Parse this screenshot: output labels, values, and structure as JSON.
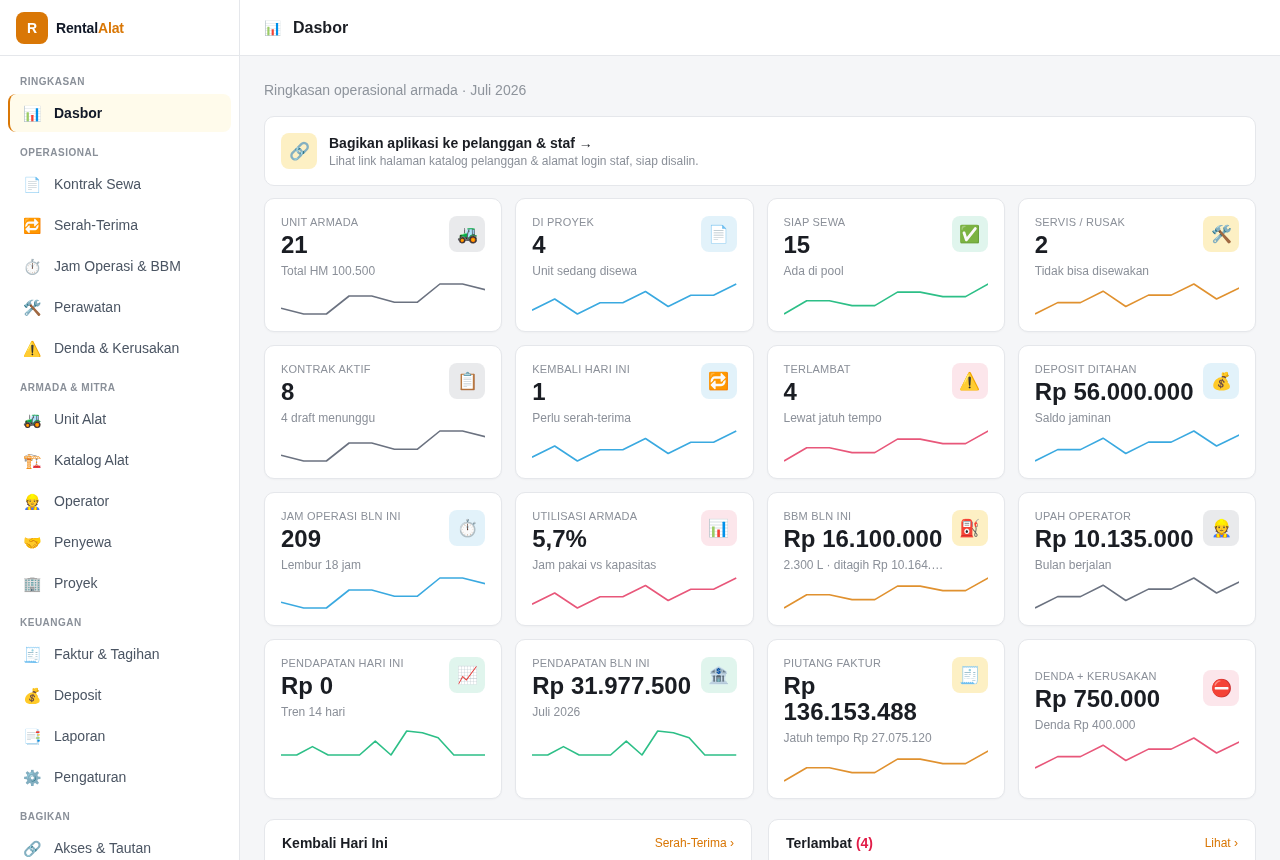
{
  "brand": {
    "logo": "R",
    "name": "Rental",
    "accent": "Alat"
  },
  "sidebar": {
    "sections": [
      {
        "title": "RINGKASAN",
        "items": [
          {
            "icon": "📊",
            "label": "Dasbor",
            "selected": true
          }
        ]
      },
      {
        "title": "OPERASIONAL",
        "items": [
          {
            "icon": "📄",
            "label": "Kontrak Sewa",
            "selected": false
          },
          {
            "icon": "🔁",
            "label": "Serah-Terima",
            "selected": false
          },
          {
            "icon": "⏱️",
            "label": "Jam Operasi & BBM",
            "selected": false
          },
          {
            "icon": "🛠️",
            "label": "Perawatan",
            "selected": false
          },
          {
            "icon": "⚠️",
            "label": "Denda & Kerusakan",
            "selected": false
          }
        ]
      },
      {
        "title": "ARMADA & MITRA",
        "items": [
          {
            "icon": "🚜",
            "label": "Unit Alat",
            "selected": false
          },
          {
            "icon": "🏗️",
            "label": "Katalog Alat",
            "selected": false
          },
          {
            "icon": "👷",
            "label": "Operator",
            "selected": false
          },
          {
            "icon": "🤝",
            "label": "Penyewa",
            "selected": false
          },
          {
            "icon": "🏢",
            "label": "Proyek",
            "selected": false
          }
        ]
      },
      {
        "title": "KEUANGAN",
        "items": [
          {
            "icon": "🧾",
            "label": "Faktur & Tagihan",
            "selected": false
          },
          {
            "icon": "💰",
            "label": "Deposit",
            "selected": false
          },
          {
            "icon": "📑",
            "label": "Laporan",
            "selected": false
          },
          {
            "icon": "⚙️",
            "label": "Pengaturan",
            "selected": false
          }
        ]
      },
      {
        "title": "BAGIKAN",
        "items": [
          {
            "icon": "🔗",
            "label": "Akses & Tautan",
            "selected": false
          }
        ]
      }
    ]
  },
  "header": {
    "icon": "📊",
    "title": "Dasbor"
  },
  "subtitle": "Ringkasan operasional armada · Juli 2026",
  "share_banner": {
    "icon": "🔗",
    "title": "Bagikan aplikasi ke pelanggan & staf →",
    "description": "Lihat link halaman katalog pelanggan & alamat login staf, siap disalin."
  },
  "stat_cards": [
    {
      "kind": "stat",
      "label": "UNIT ARMADA",
      "value": "21",
      "note": "Total HM 100.500",
      "icon": "🚜",
      "color": "#6b7280"
    },
    {
      "kind": "stat",
      "label": "DI PROYEK",
      "value": "4",
      "note": "Unit sedang disewa",
      "icon": "📄",
      "color": "#3aa9e0"
    },
    {
      "kind": "stat",
      "label": "SIAP SEWA",
      "value": "15",
      "note": "Ada di pool",
      "icon": "✅",
      "color": "#2dbf87"
    },
    {
      "kind": "stat",
      "label": "SERVIS / RUSAK",
      "value": "2",
      "note": "Tidak bisa disewakan",
      "icon": "🛠️",
      "color": "#e0912f"
    },
    {
      "kind": "stat",
      "label": "KONTRAK AKTIF",
      "value": "8",
      "note": "4 draft menunggu",
      "icon": "📋",
      "color": "#6b7280"
    },
    {
      "kind": "stat",
      "label": "KEMBALI HARI INI",
      "value": "1",
      "note": "Perlu serah-terima",
      "icon": "🔁",
      "color": "#3aa9e0"
    },
    {
      "kind": "stat",
      "label": "TERLAMBAT",
      "value": "4",
      "note": "Lewat jatuh tempo",
      "icon": "⚠️",
      "color": "#e8577a"
    },
    {
      "kind": "stat",
      "label": "DEPOSIT DITAHAN",
      "value": "Rp 56.000.000",
      "note": "Saldo jaminan",
      "icon": "💰",
      "color": "#3aa9e0"
    },
    {
      "kind": "stat",
      "label": "JAM OPERASI BLN INI",
      "value": "209",
      "note": "Lembur 18 jam",
      "icon": "⏱️",
      "color": "#3aa9e0"
    },
    {
      "kind": "stat",
      "label": "UTILISASI ARMADA",
      "value": "5,7%",
      "note": "Jam pakai vs kapasitas",
      "icon": "📊",
      "color": "#e8577a"
    },
    {
      "kind": "stat",
      "label": "BBM BLN INI",
      "value": "Rp 16.100.000",
      "note": "2.300 L · ditagih Rp 10.164.…",
      "icon": "⛽",
      "color": "#e0912f"
    },
    {
      "kind": "stat",
      "label": "UPAH OPERATOR",
      "value": "Rp 10.135.000",
      "note": "Bulan berjalan",
      "icon": "👷",
      "color": "#6b7280"
    },
    {
      "kind": "trend",
      "label": "PENDAPATAN HARI INI",
      "value": "Rp 0",
      "note": "Tren 14 hari",
      "icon": "📈",
      "color": "#2dbf87"
    },
    {
      "kind": "trend",
      "label": "PENDAPATAN BLN INI",
      "value": "Rp 31.977.500",
      "note": "Juli 2026",
      "icon": "🏦",
      "color": "#2dbf87"
    },
    {
      "kind": "stat",
      "label": "PIUTANG FAKTUR",
      "value": "Rp 136.153.488",
      "note": "Jatuh tempo Rp 27.075.120",
      "icon": "🧾",
      "color": "#e0912f"
    },
    {
      "kind": "stat",
      "label": "DENDA + KERUSAKAN",
      "value": "Rp 750.000",
      "note": "Denda Rp 400.000",
      "icon": "⛔",
      "color": "#e8577a"
    }
  ],
  "panels": [
    {
      "title": "Kembali Hari Ini",
      "link": "Serah-Terima ›"
    },
    {
      "title": "Terlambat",
      "count": "(4)",
      "link": "Lihat ›"
    }
  ]
}
